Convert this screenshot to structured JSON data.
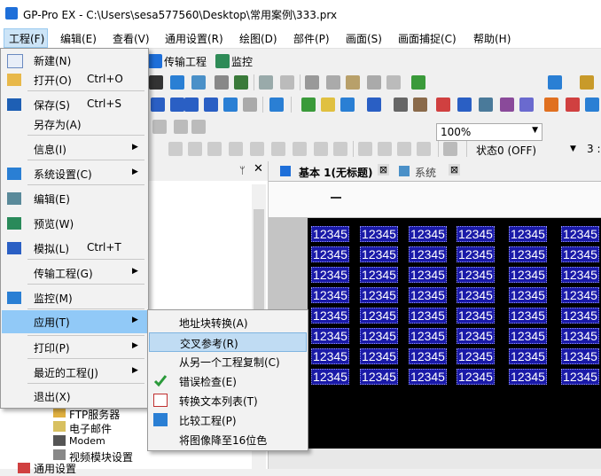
{
  "window": {
    "title": "GP-Pro EX - C:\\Users\\sesa577560\\Desktop\\常用案例\\333.prx"
  },
  "menubar": [
    "工程(F)",
    "编辑(E)",
    "查看(V)",
    "通用设置(R)",
    "绘图(D)",
    "部件(P)",
    "画面(S)",
    "画面捕捉(C)",
    "帮助(H)"
  ],
  "toolbar": {
    "transfer_label": "传输工程",
    "monitor_label": "监控",
    "zoom": "100%",
    "state": "状态0 (OFF)",
    "state_extra": "3 :"
  },
  "left_panel": {
    "tree": [
      "FTP服务器",
      "电子邮件",
      "Modem",
      "视频模块设置",
      "通用设置"
    ]
  },
  "tabs": [
    {
      "label": "基本 1(无标题)",
      "close": "⊠"
    },
    {
      "label": "系统",
      "close": "⊠"
    }
  ],
  "screen": {
    "cell_value": "12345",
    "rows": 8,
    "cols": 6
  },
  "file_menu": {
    "items": [
      {
        "label": "新建(N)",
        "shortcut": "",
        "submenu": false,
        "icon": "new-icon"
      },
      {
        "label": "打开(O)",
        "shortcut": "Ctrl+O",
        "submenu": false,
        "icon": "open-folder-icon"
      },
      {
        "label": "保存(S)",
        "shortcut": "Ctrl+S",
        "submenu": false,
        "icon": "save-icon"
      },
      {
        "label": "另存为(A)",
        "shortcut": "",
        "submenu": false,
        "icon": ""
      },
      {
        "label": "信息(I)",
        "shortcut": "",
        "submenu": true,
        "icon": ""
      },
      {
        "label": "系统设置(C)",
        "shortcut": "",
        "submenu": true,
        "icon": "system-settings-icon"
      },
      {
        "label": "编辑(E)",
        "shortcut": "",
        "submenu": false,
        "icon": "edit-tools-icon"
      },
      {
        "label": "预览(W)",
        "shortcut": "",
        "submenu": false,
        "icon": "preview-icon"
      },
      {
        "label": "模拟(L)",
        "shortcut": "Ctrl+T",
        "submenu": false,
        "icon": "simulation-icon"
      },
      {
        "label": "传输工程(G)",
        "shortcut": "",
        "submenu": true,
        "icon": ""
      },
      {
        "label": "监控(M)",
        "shortcut": "",
        "submenu": false,
        "icon": "monitor-icon"
      },
      {
        "label": "应用(T)",
        "shortcut": "",
        "submenu": true,
        "icon": ""
      },
      {
        "label": "打印(P)",
        "shortcut": "",
        "submenu": true,
        "icon": ""
      },
      {
        "label": "最近的工程(J)",
        "shortcut": "",
        "submenu": true,
        "icon": ""
      },
      {
        "label": "退出(X)",
        "shortcut": "",
        "submenu": false,
        "icon": ""
      }
    ]
  },
  "apply_submenu": {
    "items": [
      "地址块转换(A)",
      "交叉参考(R)",
      "从另一个工程复制(C)",
      "错误检查(E)",
      "转换文本列表(T)",
      "比较工程(P)",
      "将图像降至16位色"
    ]
  },
  "colors": {
    "highlight": "#91c9f7",
    "hover": "#c0dcf3",
    "screen_bg": "#000000",
    "cell_bg": "#1a1aa8"
  }
}
